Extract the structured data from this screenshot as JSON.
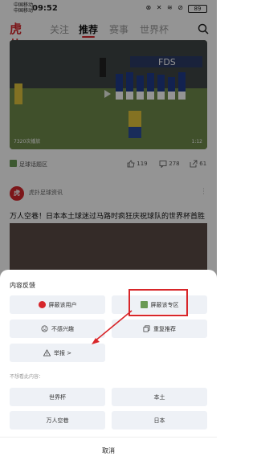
{
  "status_bar": {
    "carrier_1": "中国移动",
    "carrier_2": "中国移动",
    "time": "09:52",
    "icons": "⊗ ✕ ≋ ⊘",
    "battery": "89"
  },
  "nav": {
    "tabs": [
      {
        "label": "关注",
        "active": false
      },
      {
        "label": "推荐",
        "active": true
      },
      {
        "label": "赛事",
        "active": false
      },
      {
        "label": "世界杯",
        "active": false
      }
    ],
    "logo": "虎扑"
  },
  "video_card": {
    "views": "7320次播放",
    "duration": "1:12",
    "source": "足球话题区",
    "likes": "119",
    "comments": "278",
    "shares": "61"
  },
  "post2": {
    "author": "虎扑足球资讯",
    "title": "万人空巷！日本本土球迷过马路时疯狂庆祝球队的世界杯首胜"
  },
  "sheet": {
    "title": "内容反馈",
    "options": [
      {
        "label": "屏蔽该用户",
        "icon": "user-block-icon"
      },
      {
        "label": "屏蔽该专区",
        "icon": "zone-image-icon"
      },
      {
        "label": "不感兴趣",
        "icon": "sad-face-icon"
      },
      {
        "label": "重复推荐",
        "icon": "duplicate-icon"
      },
      {
        "label": "举报 >",
        "icon": "warning-icon"
      }
    ],
    "hint": "不想看此内容：",
    "topics": [
      "世界杯",
      "本土",
      "万人空巷",
      "日本"
    ],
    "cancel": "取消"
  },
  "colors": {
    "accent": "#d6262b",
    "option_bg": "#eef1f6"
  }
}
